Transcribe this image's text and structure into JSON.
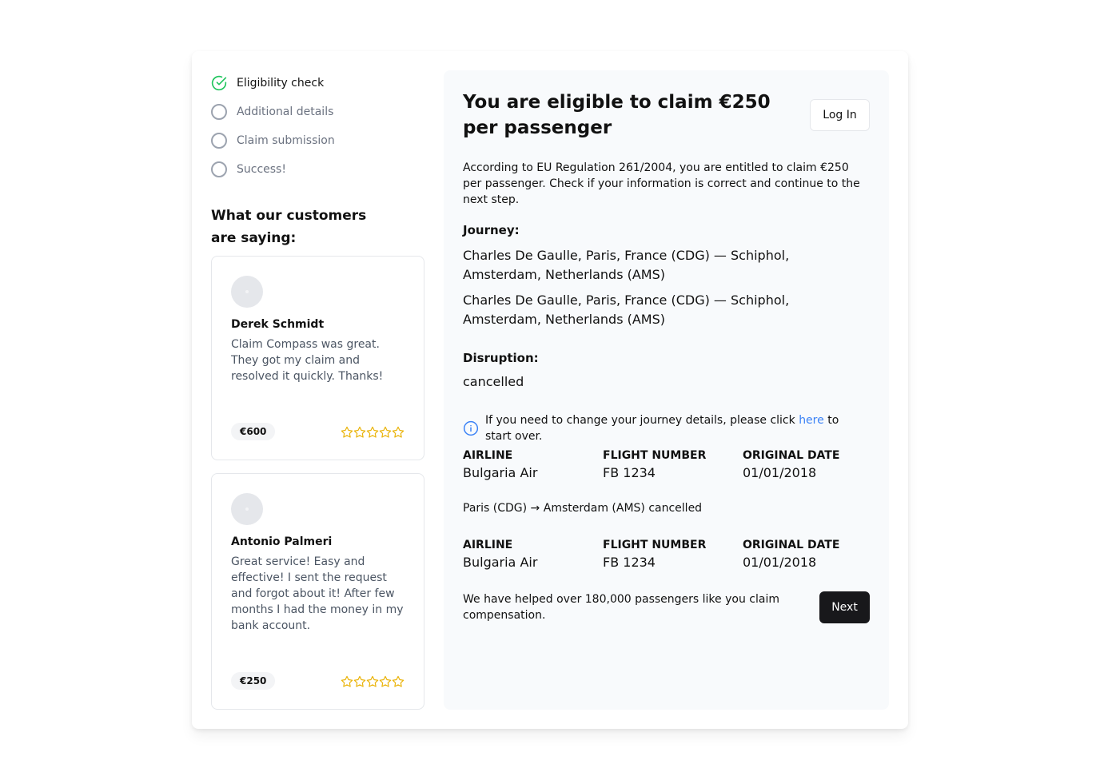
{
  "steps": [
    {
      "label": "Eligibility check",
      "status": "done"
    },
    {
      "label": "Additional details",
      "status": "pending"
    },
    {
      "label": "Claim submission",
      "status": "pending"
    },
    {
      "label": "Success!",
      "status": "pending"
    }
  ],
  "testimonials": {
    "title": "What our customers are saying:",
    "items": [
      {
        "name": "Derek Schmidt",
        "text": "Claim Compass was great. They got my claim and resolved it quickly. Thanks!",
        "amount": "€600",
        "rating": 5
      },
      {
        "name": "Antonio Palmeri",
        "text": "Great service! Easy and effective! I sent the request and forgot about it! After few months I had the money in my bank account.",
        "amount": "€250",
        "rating": 5
      }
    ]
  },
  "main": {
    "title": "You are eligible to claim €250 per passenger",
    "login_label": "Log In",
    "intro": "According to EU Regulation 261/2004, you are entitled to claim €250 per passenger. Check if your information is correct and continue to the next step.",
    "journey_heading": "Journey:",
    "journeys": [
      "Charles De Gaulle, Paris, France (CDG) — Schiphol, Amsterdam, Netherlands (AMS)",
      "Charles De Gaulle, Paris, France (CDG) — Schiphol, Amsterdam, Netherlands (AMS)"
    ],
    "disruption_heading": "Disruption:",
    "disruption": "cancelled",
    "info_before": "If you need to change your journey details, please click ",
    "info_link": "here",
    "info_after": " to start over.",
    "headers": {
      "airline": "AIRLINE",
      "flight_number": "FLIGHT NUMBER",
      "original_date": "ORIGINAL DATE"
    },
    "flights": [
      {
        "airline": "Bulgaria Air",
        "flight_number": "FB 1234",
        "original_date": "01/01/2018"
      },
      {
        "airline": "Bulgaria Air",
        "flight_number": "FB 1234",
        "original_date": "01/01/2018"
      }
    ],
    "segment": "Paris (CDG) → Amsterdam (AMS) cancelled",
    "footer_text": "We have helped over 180,000 passengers like you claim compensation.",
    "next_label": "Next"
  },
  "colors": {
    "accent_green": "#22c55e",
    "link_blue": "#3b82f6",
    "star_gold": "#eab308",
    "button_dark": "#18181b"
  },
  "icons": {
    "done_step": "check-circle-icon",
    "pending_step": "empty-circle-icon",
    "info": "info-icon",
    "rating": "star-outline-icon"
  }
}
